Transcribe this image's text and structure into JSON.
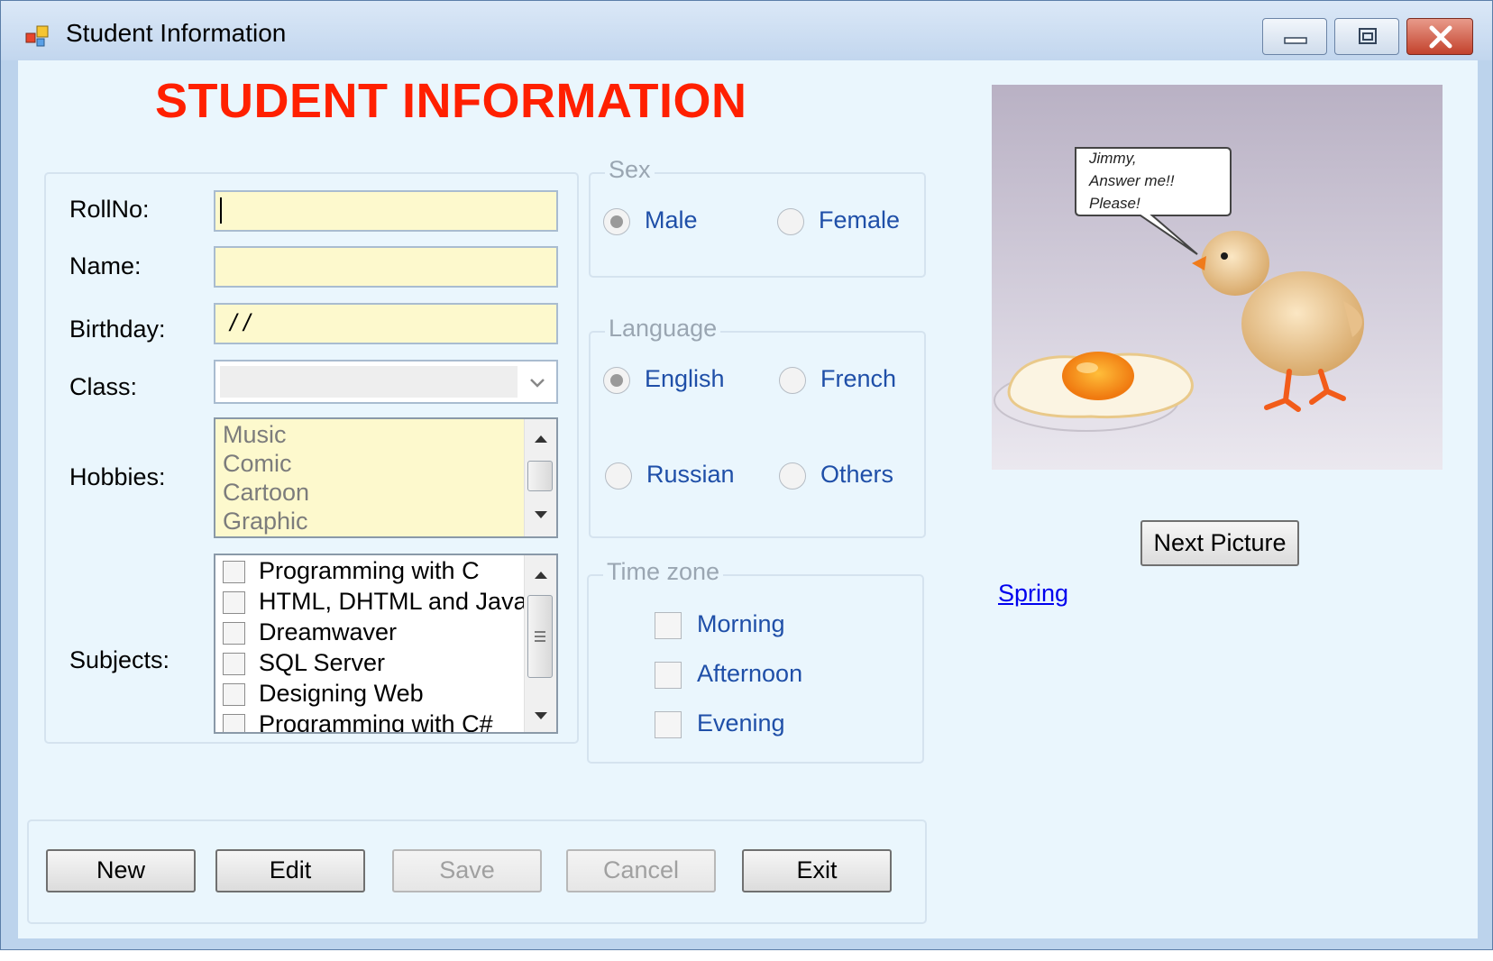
{
  "window": {
    "title": "Student Information"
  },
  "heading": "STUDENT INFORMATION",
  "form": {
    "rollno_label": "RollNo:",
    "rollno_value": "",
    "name_label": "Name:",
    "name_value": "",
    "birthday_label": "Birthday:",
    "birthday_value": "/ /",
    "class_label": "Class:",
    "class_value": "",
    "hobbies_label": "Hobbies:",
    "hobbies": [
      "Music",
      "Comic",
      "Cartoon",
      "Graphic"
    ],
    "subjects_label": "Subjects:",
    "subjects": [
      "Programming with C",
      "HTML, DHTML and Java",
      "Dreamwaver",
      "SQL Server",
      "Designing Web",
      "Programming with C#"
    ]
  },
  "sex": {
    "legend": "Sex",
    "options": [
      "Male",
      "Female"
    ],
    "selected": "Male"
  },
  "language": {
    "legend": "Language",
    "options": [
      "English",
      "French",
      "Russian",
      "Others"
    ],
    "selected": "English"
  },
  "timezone": {
    "legend": "Time zone",
    "options": [
      "Morning",
      "Afternoon",
      "Evening"
    ]
  },
  "buttons": {
    "new": "New",
    "edit": "Edit",
    "save": "Save",
    "cancel": "Cancel",
    "exit": "Exit",
    "next_picture": "Next Picture"
  },
  "picture": {
    "speech_lines": [
      "Jimmy,",
      "Answer me!!",
      "Please!"
    ]
  },
  "link": "Spring",
  "colors": {
    "heading": "#ff2000",
    "option_text": "#1f4fa8",
    "field_bg": "#fdf9cd",
    "client_bg": "#eaf6fd"
  }
}
